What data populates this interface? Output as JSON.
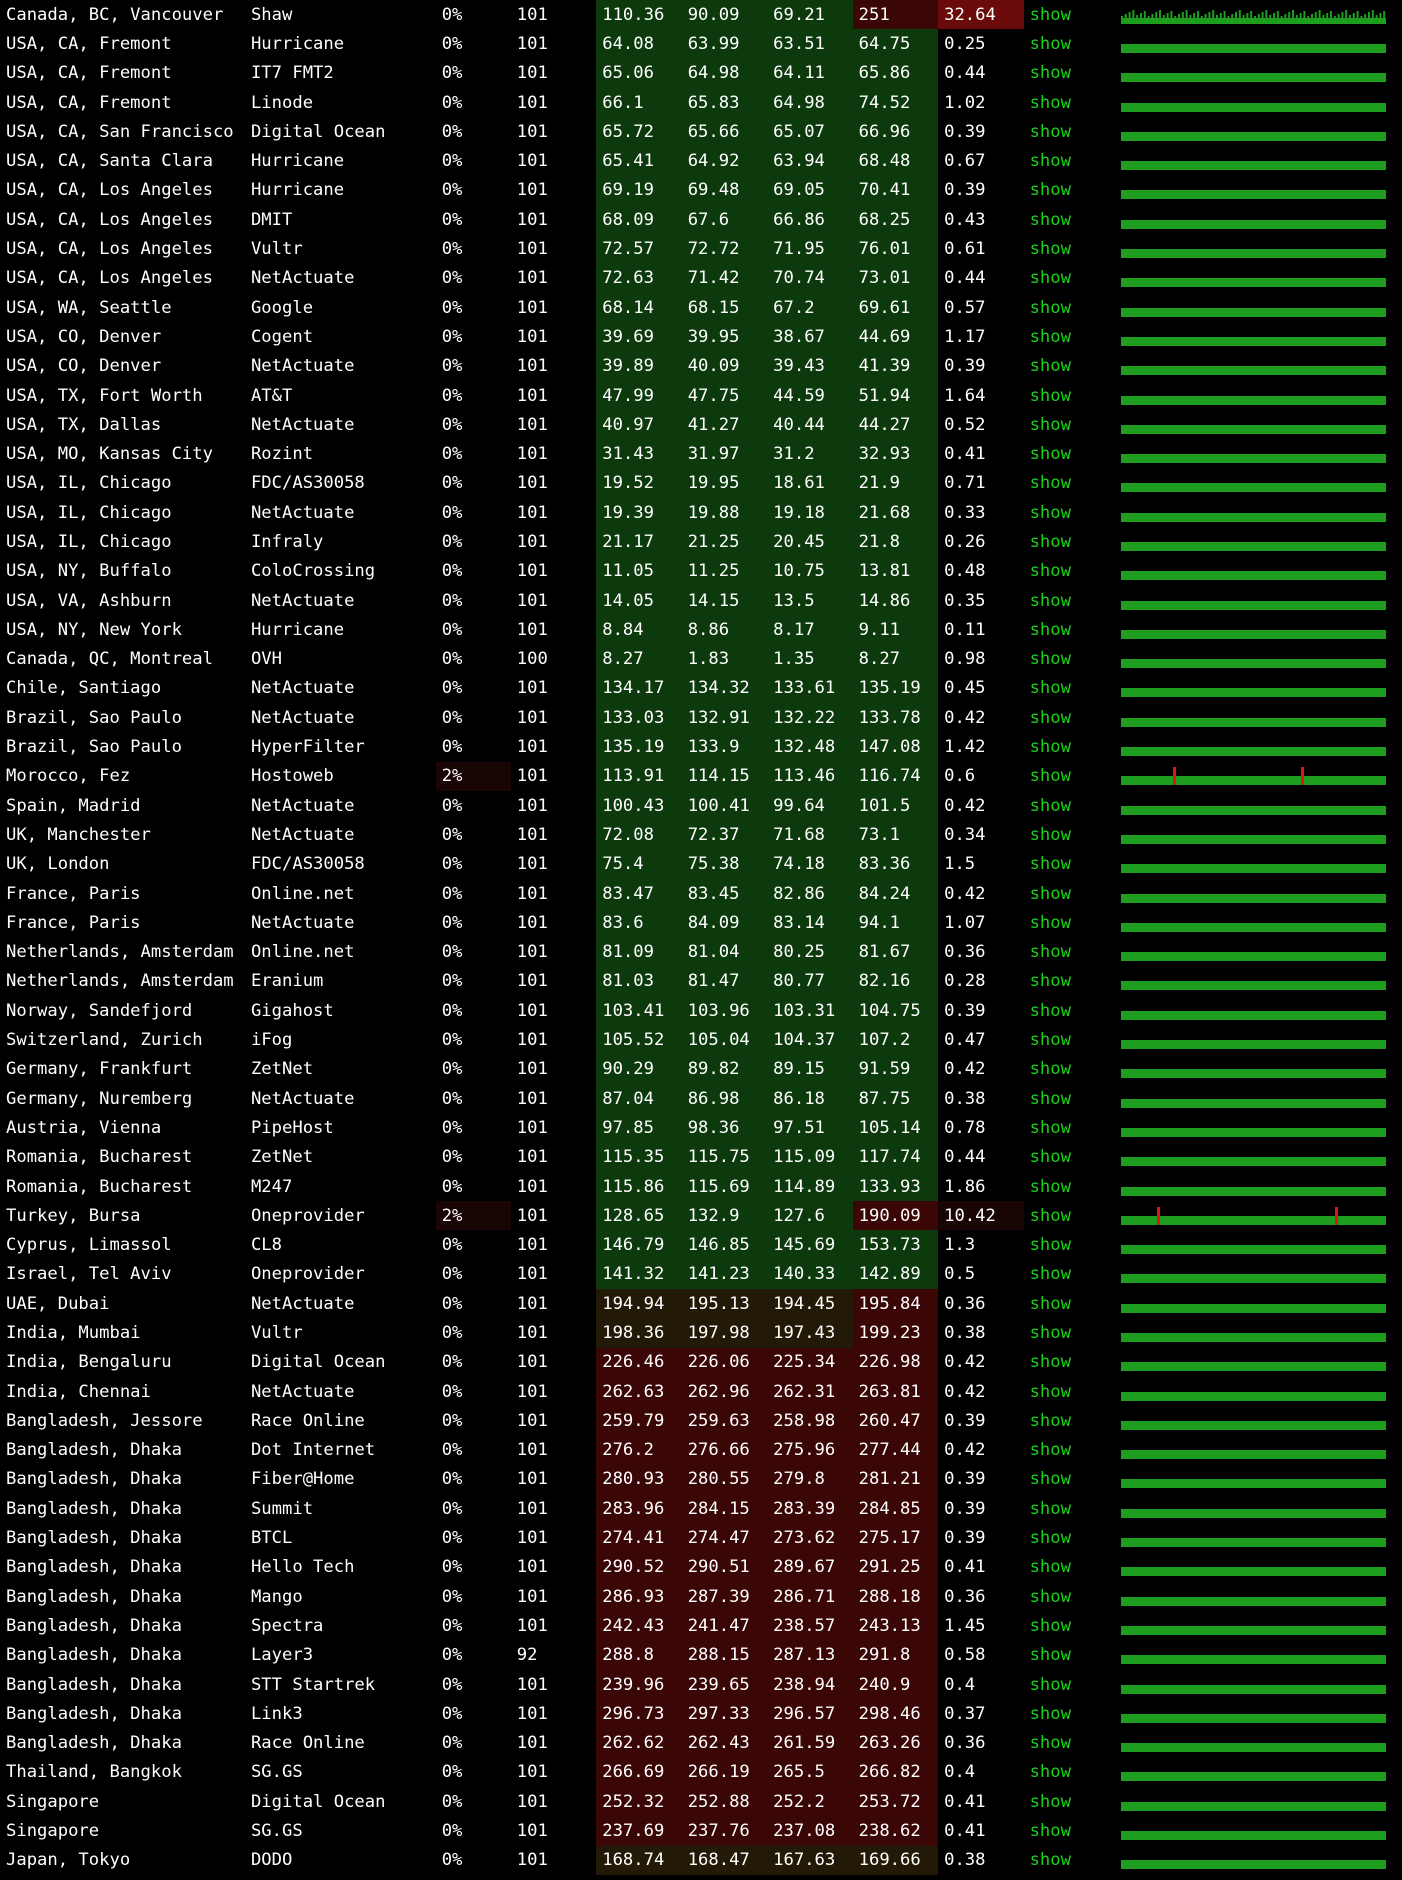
{
  "rows": [
    {
      "location": "Canada, BC, Vancouver",
      "provider": "Shaw",
      "loss": "0%",
      "count": "101",
      "last": "110.36",
      "avg": "90.09",
      "best": "69.21",
      "worst": "251",
      "stdev": "32.64",
      "show": "show",
      "graph": "spiky"
    },
    {
      "location": "USA, CA, Fremont",
      "provider": "Hurricane",
      "loss": "0%",
      "count": "101",
      "last": "64.08",
      "avg": "63.99",
      "best": "63.51",
      "worst": "64.75",
      "stdev": "0.25",
      "show": "show",
      "graph": "flat"
    },
    {
      "location": "USA, CA, Fremont",
      "provider": "IT7 FMT2",
      "loss": "0%",
      "count": "101",
      "last": "65.06",
      "avg": "64.98",
      "best": "64.11",
      "worst": "65.86",
      "stdev": "0.44",
      "show": "show",
      "graph": "flat"
    },
    {
      "location": "USA, CA, Fremont",
      "provider": "Linode",
      "loss": "0%",
      "count": "101",
      "last": "66.1",
      "avg": "65.83",
      "best": "64.98",
      "worst": "74.52",
      "stdev": "1.02",
      "show": "show",
      "graph": "flat"
    },
    {
      "location": "USA, CA, San Francisco",
      "provider": "Digital Ocean",
      "loss": "0%",
      "count": "101",
      "last": "65.72",
      "avg": "65.66",
      "best": "65.07",
      "worst": "66.96",
      "stdev": "0.39",
      "show": "show",
      "graph": "flat"
    },
    {
      "location": "USA, CA, Santa Clara",
      "provider": "Hurricane",
      "loss": "0%",
      "count": "101",
      "last": "65.41",
      "avg": "64.92",
      "best": "63.94",
      "worst": "68.48",
      "stdev": "0.67",
      "show": "show",
      "graph": "flat"
    },
    {
      "location": "USA, CA, Los Angeles",
      "provider": "Hurricane",
      "loss": "0%",
      "count": "101",
      "last": "69.19",
      "avg": "69.48",
      "best": "69.05",
      "worst": "70.41",
      "stdev": "0.39",
      "show": "show",
      "graph": "flat"
    },
    {
      "location": "USA, CA, Los Angeles",
      "provider": "DMIT",
      "loss": "0%",
      "count": "101",
      "last": "68.09",
      "avg": "67.6",
      "best": "66.86",
      "worst": "68.25",
      "stdev": "0.43",
      "show": "show",
      "graph": "flat"
    },
    {
      "location": "USA, CA, Los Angeles",
      "provider": "Vultr",
      "loss": "0%",
      "count": "101",
      "last": "72.57",
      "avg": "72.72",
      "best": "71.95",
      "worst": "76.01",
      "stdev": "0.61",
      "show": "show",
      "graph": "flat"
    },
    {
      "location": "USA, CA, Los Angeles",
      "provider": "NetActuate",
      "loss": "0%",
      "count": "101",
      "last": "72.63",
      "avg": "71.42",
      "best": "70.74",
      "worst": "73.01",
      "stdev": "0.44",
      "show": "show",
      "graph": "flat"
    },
    {
      "location": "USA, WA, Seattle",
      "provider": "Google",
      "loss": "0%",
      "count": "101",
      "last": "68.14",
      "avg": "68.15",
      "best": "67.2",
      "worst": "69.61",
      "stdev": "0.57",
      "show": "show",
      "graph": "flat"
    },
    {
      "location": "USA, CO, Denver",
      "provider": "Cogent",
      "loss": "0%",
      "count": "101",
      "last": "39.69",
      "avg": "39.95",
      "best": "38.67",
      "worst": "44.69",
      "stdev": "1.17",
      "show": "show",
      "graph": "flat"
    },
    {
      "location": "USA, CO, Denver",
      "provider": "NetActuate",
      "loss": "0%",
      "count": "101",
      "last": "39.89",
      "avg": "40.09",
      "best": "39.43",
      "worst": "41.39",
      "stdev": "0.39",
      "show": "show",
      "graph": "flat"
    },
    {
      "location": "USA, TX, Fort Worth",
      "provider": "AT&T",
      "loss": "0%",
      "count": "101",
      "last": "47.99",
      "avg": "47.75",
      "best": "44.59",
      "worst": "51.94",
      "stdev": "1.64",
      "show": "show",
      "graph": "flat"
    },
    {
      "location": "USA, TX, Dallas",
      "provider": "NetActuate",
      "loss": "0%",
      "count": "101",
      "last": "40.97",
      "avg": "41.27",
      "best": "40.44",
      "worst": "44.27",
      "stdev": "0.52",
      "show": "show",
      "graph": "flat"
    },
    {
      "location": "USA, MO, Kansas City",
      "provider": "Rozint",
      "loss": "0%",
      "count": "101",
      "last": "31.43",
      "avg": "31.97",
      "best": "31.2",
      "worst": "32.93",
      "stdev": "0.41",
      "show": "show",
      "graph": "flat"
    },
    {
      "location": "USA, IL, Chicago",
      "provider": "FDC/AS30058",
      "loss": "0%",
      "count": "101",
      "last": "19.52",
      "avg": "19.95",
      "best": "18.61",
      "worst": "21.9",
      "stdev": "0.71",
      "show": "show",
      "graph": "flat"
    },
    {
      "location": "USA, IL, Chicago",
      "provider": "NetActuate",
      "loss": "0%",
      "count": "101",
      "last": "19.39",
      "avg": "19.88",
      "best": "19.18",
      "worst": "21.68",
      "stdev": "0.33",
      "show": "show",
      "graph": "flat"
    },
    {
      "location": "USA, IL, Chicago",
      "provider": "Infraly",
      "loss": "0%",
      "count": "101",
      "last": "21.17",
      "avg": "21.25",
      "best": "20.45",
      "worst": "21.8",
      "stdev": "0.26",
      "show": "show",
      "graph": "flat"
    },
    {
      "location": "USA, NY, Buffalo",
      "provider": "ColoCrossing",
      "loss": "0%",
      "count": "101",
      "last": "11.05",
      "avg": "11.25",
      "best": "10.75",
      "worst": "13.81",
      "stdev": "0.48",
      "show": "show",
      "graph": "flat"
    },
    {
      "location": "USA, VA, Ashburn",
      "provider": "NetActuate",
      "loss": "0%",
      "count": "101",
      "last": "14.05",
      "avg": "14.15",
      "best": "13.5",
      "worst": "14.86",
      "stdev": "0.35",
      "show": "show",
      "graph": "flat"
    },
    {
      "location": "USA, NY, New York",
      "provider": "Hurricane",
      "loss": "0%",
      "count": "101",
      "last": "8.84",
      "avg": "8.86",
      "best": "8.17",
      "worst": "9.11",
      "stdev": "0.11",
      "show": "show",
      "graph": "flat"
    },
    {
      "location": "Canada, QC, Montreal",
      "provider": "OVH",
      "loss": "0%",
      "count": "100",
      "last": "8.27",
      "avg": "1.83",
      "best": "1.35",
      "worst": "8.27",
      "stdev": "0.98",
      "show": "show",
      "graph": "flat"
    },
    {
      "location": "Chile, Santiago",
      "provider": "NetActuate",
      "loss": "0%",
      "count": "101",
      "last": "134.17",
      "avg": "134.32",
      "best": "133.61",
      "worst": "135.19",
      "stdev": "0.45",
      "show": "show",
      "graph": "flat"
    },
    {
      "location": "Brazil, Sao Paulo",
      "provider": "NetActuate",
      "loss": "0%",
      "count": "101",
      "last": "133.03",
      "avg": "132.91",
      "best": "132.22",
      "worst": "133.78",
      "stdev": "0.42",
      "show": "show",
      "graph": "flat"
    },
    {
      "location": "Brazil, Sao Paulo",
      "provider": "HyperFilter",
      "loss": "0%",
      "count": "101",
      "last": "135.19",
      "avg": "133.9",
      "best": "132.48",
      "worst": "147.08",
      "stdev": "1.42",
      "show": "show",
      "graph": "flat"
    },
    {
      "location": "Morocco, Fez",
      "provider": "Hostoweb",
      "loss": "2%",
      "count": "101",
      "last": "113.91",
      "avg": "114.15",
      "best": "113.46",
      "worst": "116.74",
      "stdev": "0.6",
      "show": "show",
      "graph": "loss"
    },
    {
      "location": "Spain, Madrid",
      "provider": "NetActuate",
      "loss": "0%",
      "count": "101",
      "last": "100.43",
      "avg": "100.41",
      "best": "99.64",
      "worst": "101.5",
      "stdev": "0.42",
      "show": "show",
      "graph": "flat"
    },
    {
      "location": "UK, Manchester",
      "provider": "NetActuate",
      "loss": "0%",
      "count": "101",
      "last": "72.08",
      "avg": "72.37",
      "best": "71.68",
      "worst": "73.1",
      "stdev": "0.34",
      "show": "show",
      "graph": "flat"
    },
    {
      "location": "UK, London",
      "provider": "FDC/AS30058",
      "loss": "0%",
      "count": "101",
      "last": "75.4",
      "avg": "75.38",
      "best": "74.18",
      "worst": "83.36",
      "stdev": "1.5",
      "show": "show",
      "graph": "flat"
    },
    {
      "location": "France, Paris",
      "provider": "Online.net",
      "loss": "0%",
      "count": "101",
      "last": "83.47",
      "avg": "83.45",
      "best": "82.86",
      "worst": "84.24",
      "stdev": "0.42",
      "show": "show",
      "graph": "flat"
    },
    {
      "location": "France, Paris",
      "provider": "NetActuate",
      "loss": "0%",
      "count": "101",
      "last": "83.6",
      "avg": "84.09",
      "best": "83.14",
      "worst": "94.1",
      "stdev": "1.07",
      "show": "show",
      "graph": "flat"
    },
    {
      "location": "Netherlands, Amsterdam",
      "provider": "Online.net",
      "loss": "0%",
      "count": "101",
      "last": "81.09",
      "avg": "81.04",
      "best": "80.25",
      "worst": "81.67",
      "stdev": "0.36",
      "show": "show",
      "graph": "flat"
    },
    {
      "location": "Netherlands, Amsterdam",
      "provider": "Eranium",
      "loss": "0%",
      "count": "101",
      "last": "81.03",
      "avg": "81.47",
      "best": "80.77",
      "worst": "82.16",
      "stdev": "0.28",
      "show": "show",
      "graph": "flat"
    },
    {
      "location": "Norway, Sandefjord",
      "provider": "Gigahost",
      "loss": "0%",
      "count": "101",
      "last": "103.41",
      "avg": "103.96",
      "best": "103.31",
      "worst": "104.75",
      "stdev": "0.39",
      "show": "show",
      "graph": "flat"
    },
    {
      "location": "Switzerland, Zurich",
      "provider": "iFog",
      "loss": "0%",
      "count": "101",
      "last": "105.52",
      "avg": "105.04",
      "best": "104.37",
      "worst": "107.2",
      "stdev": "0.47",
      "show": "show",
      "graph": "flat"
    },
    {
      "location": "Germany, Frankfurt",
      "provider": "ZetNet",
      "loss": "0%",
      "count": "101",
      "last": "90.29",
      "avg": "89.82",
      "best": "89.15",
      "worst": "91.59",
      "stdev": "0.42",
      "show": "show",
      "graph": "flat"
    },
    {
      "location": "Germany, Nuremberg",
      "provider": "NetActuate",
      "loss": "0%",
      "count": "101",
      "last": "87.04",
      "avg": "86.98",
      "best": "86.18",
      "worst": "87.75",
      "stdev": "0.38",
      "show": "show",
      "graph": "flat"
    },
    {
      "location": "Austria, Vienna",
      "provider": "PipeHost",
      "loss": "0%",
      "count": "101",
      "last": "97.85",
      "avg": "98.36",
      "best": "97.51",
      "worst": "105.14",
      "stdev": "0.78",
      "show": "show",
      "graph": "flat"
    },
    {
      "location": "Romania, Bucharest",
      "provider": "ZetNet",
      "loss": "0%",
      "count": "101",
      "last": "115.35",
      "avg": "115.75",
      "best": "115.09",
      "worst": "117.74",
      "stdev": "0.44",
      "show": "show",
      "graph": "flat"
    },
    {
      "location": "Romania, Bucharest",
      "provider": "M247",
      "loss": "0%",
      "count": "101",
      "last": "115.86",
      "avg": "115.69",
      "best": "114.89",
      "worst": "133.93",
      "stdev": "1.86",
      "show": "show",
      "graph": "flat"
    },
    {
      "location": "Turkey, Bursa",
      "provider": "Oneprovider",
      "loss": "2%",
      "count": "101",
      "last": "128.65",
      "avg": "132.9",
      "best": "127.6",
      "worst": "190.09",
      "stdev": "10.42",
      "show": "show",
      "graph": "loss-spiky"
    },
    {
      "location": "Cyprus, Limassol",
      "provider": "CL8",
      "loss": "0%",
      "count": "101",
      "last": "146.79",
      "avg": "146.85",
      "best": "145.69",
      "worst": "153.73",
      "stdev": "1.3",
      "show": "show",
      "graph": "flat"
    },
    {
      "location": "Israel, Tel Aviv",
      "provider": "Oneprovider",
      "loss": "0%",
      "count": "101",
      "last": "141.32",
      "avg": "141.23",
      "best": "140.33",
      "worst": "142.89",
      "stdev": "0.5",
      "show": "show",
      "graph": "flat"
    },
    {
      "location": "UAE, Dubai",
      "provider": "NetActuate",
      "loss": "0%",
      "count": "101",
      "last": "194.94",
      "avg": "195.13",
      "best": "194.45",
      "worst": "195.84",
      "stdev": "0.36",
      "show": "show",
      "graph": "flat"
    },
    {
      "location": "India, Mumbai",
      "provider": "Vultr",
      "loss": "0%",
      "count": "101",
      "last": "198.36",
      "avg": "197.98",
      "best": "197.43",
      "worst": "199.23",
      "stdev": "0.38",
      "show": "show",
      "graph": "flat"
    },
    {
      "location": "India, Bengaluru",
      "provider": "Digital Ocean",
      "loss": "0%",
      "count": "101",
      "last": "226.46",
      "avg": "226.06",
      "best": "225.34",
      "worst": "226.98",
      "stdev": "0.42",
      "show": "show",
      "graph": "flat"
    },
    {
      "location": "India, Chennai",
      "provider": "NetActuate",
      "loss": "0%",
      "count": "101",
      "last": "262.63",
      "avg": "262.96",
      "best": "262.31",
      "worst": "263.81",
      "stdev": "0.42",
      "show": "show",
      "graph": "flat"
    },
    {
      "location": "Bangladesh, Jessore",
      "provider": "Race Online",
      "loss": "0%",
      "count": "101",
      "last": "259.79",
      "avg": "259.63",
      "best": "258.98",
      "worst": "260.47",
      "stdev": "0.39",
      "show": "show",
      "graph": "flat"
    },
    {
      "location": "Bangladesh, Dhaka",
      "provider": "Dot Internet",
      "loss": "0%",
      "count": "101",
      "last": "276.2",
      "avg": "276.66",
      "best": "275.96",
      "worst": "277.44",
      "stdev": "0.42",
      "show": "show",
      "graph": "flat"
    },
    {
      "location": "Bangladesh, Dhaka",
      "provider": "Fiber@Home",
      "loss": "0%",
      "count": "101",
      "last": "280.93",
      "avg": "280.55",
      "best": "279.8",
      "worst": "281.21",
      "stdev": "0.39",
      "show": "show",
      "graph": "flat"
    },
    {
      "location": "Bangladesh, Dhaka",
      "provider": "Summit",
      "loss": "0%",
      "count": "101",
      "last": "283.96",
      "avg": "284.15",
      "best": "283.39",
      "worst": "284.85",
      "stdev": "0.39",
      "show": "show",
      "graph": "flat"
    },
    {
      "location": "Bangladesh, Dhaka",
      "provider": "BTCL",
      "loss": "0%",
      "count": "101",
      "last": "274.41",
      "avg": "274.47",
      "best": "273.62",
      "worst": "275.17",
      "stdev": "0.39",
      "show": "show",
      "graph": "flat"
    },
    {
      "location": "Bangladesh, Dhaka",
      "provider": "Hello Tech",
      "loss": "0%",
      "count": "101",
      "last": "290.52",
      "avg": "290.51",
      "best": "289.67",
      "worst": "291.25",
      "stdev": "0.41",
      "show": "show",
      "graph": "flat"
    },
    {
      "location": "Bangladesh, Dhaka",
      "provider": "Mango",
      "loss": "0%",
      "count": "101",
      "last": "286.93",
      "avg": "287.39",
      "best": "286.71",
      "worst": "288.18",
      "stdev": "0.36",
      "show": "show",
      "graph": "flat"
    },
    {
      "location": "Bangladesh, Dhaka",
      "provider": "Spectra",
      "loss": "0%",
      "count": "101",
      "last": "242.43",
      "avg": "241.47",
      "best": "238.57",
      "worst": "243.13",
      "stdev": "1.45",
      "show": "show",
      "graph": "flat"
    },
    {
      "location": "Bangladesh, Dhaka",
      "provider": "Layer3",
      "loss": "0%",
      "count": "92",
      "last": "288.8",
      "avg": "288.15",
      "best": "287.13",
      "worst": "291.8",
      "stdev": "0.58",
      "show": "show",
      "graph": "flat"
    },
    {
      "location": "Bangladesh, Dhaka",
      "provider": "STT Startrek",
      "loss": "0%",
      "count": "101",
      "last": "239.96",
      "avg": "239.65",
      "best": "238.94",
      "worst": "240.9",
      "stdev": "0.4",
      "show": "show",
      "graph": "flat"
    },
    {
      "location": "Bangladesh, Dhaka",
      "provider": "Link3",
      "loss": "0%",
      "count": "101",
      "last": "296.73",
      "avg": "297.33",
      "best": "296.57",
      "worst": "298.46",
      "stdev": "0.37",
      "show": "show",
      "graph": "flat"
    },
    {
      "location": "Bangladesh, Dhaka",
      "provider": "Race Online",
      "loss": "0%",
      "count": "101",
      "last": "262.62",
      "avg": "262.43",
      "best": "261.59",
      "worst": "263.26",
      "stdev": "0.36",
      "show": "show",
      "graph": "flat"
    },
    {
      "location": "Thailand, Bangkok",
      "provider": "SG.GS",
      "loss": "0%",
      "count": "101",
      "last": "266.69",
      "avg": "266.19",
      "best": "265.5",
      "worst": "266.82",
      "stdev": "0.4",
      "show": "show",
      "graph": "flat"
    },
    {
      "location": "Singapore",
      "provider": "Digital Ocean",
      "loss": "0%",
      "count": "101",
      "last": "252.32",
      "avg": "252.88",
      "best": "252.2",
      "worst": "253.72",
      "stdev": "0.41",
      "show": "show",
      "graph": "flat"
    },
    {
      "location": "Singapore",
      "provider": "SG.GS",
      "loss": "0%",
      "count": "101",
      "last": "237.69",
      "avg": "237.76",
      "best": "237.08",
      "worst": "238.62",
      "stdev": "0.41",
      "show": "show",
      "graph": "flat"
    },
    {
      "location": "Japan, Tokyo",
      "provider": "DODO",
      "loss": "0%",
      "count": "101",
      "last": "168.74",
      "avg": "168.47",
      "best": "167.63",
      "worst": "169.66",
      "stdev": "0.38",
      "show": "show",
      "graph": "flat"
    }
  ],
  "colors": {
    "text": "#ffffff",
    "background": "#000000",
    "show_link": "#19d119",
    "graph_green": "#1e9e1e",
    "graph_loss": "#e01414",
    "latency_low_bg": "#0f3a0f",
    "latency_high_bg": "#3a0a0a",
    "stdev_high_bg": "#6a0a0a"
  }
}
